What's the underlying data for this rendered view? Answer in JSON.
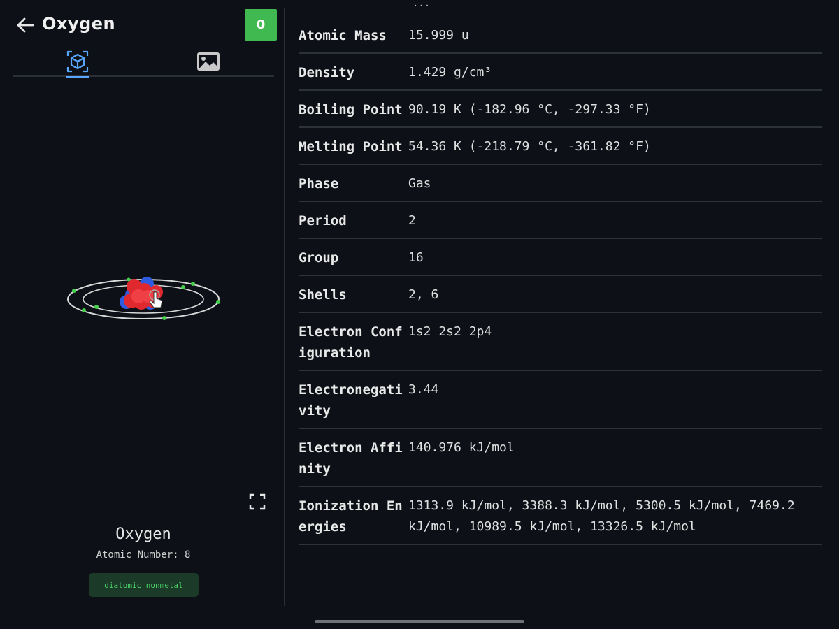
{
  "header": {
    "title": "Oxygen",
    "badge": "0"
  },
  "tabs": [
    {
      "icon": "atom-3d-icon",
      "active": true
    },
    {
      "icon": "image-icon",
      "active": false
    }
  ],
  "element": {
    "name": "Oxygen",
    "atomic_number_label": "Atomic Number: 8",
    "category": "diatomic nonmetal"
  },
  "properties": [
    {
      "key": "Atomic Mass",
      "value": "15.999 u"
    },
    {
      "key": "Density",
      "value": "1.429 g/cm³"
    },
    {
      "key": "Boiling Point",
      "value": "90.19 K (-182.96 °C, -297.33 °F)"
    },
    {
      "key": "Melting Point",
      "value": "54.36 K (-218.79 °C, -361.82 °F)"
    },
    {
      "key": "Phase",
      "value": "Gas"
    },
    {
      "key": "Period",
      "value": "2"
    },
    {
      "key": "Group",
      "value": "16"
    },
    {
      "key": "Shells",
      "value": "2, 6"
    },
    {
      "key": "Electron Configuration",
      "value": "1s2 2s2 2p4"
    },
    {
      "key": "Electronegativity",
      "value": "3.44"
    },
    {
      "key": "Electron Affinity",
      "value": "140.976 kJ/mol"
    },
    {
      "key": "Ionization Energies",
      "value": "1313.9 kJ/mol, 3388.3 kJ/mol, 5300.5 kJ/mol, 7469.2 kJ/mol, 10989.5 kJ/mol, 13326.5 kJ/mol"
    }
  ],
  "colors": {
    "background": "#0d1117",
    "accent": "#58a6ff",
    "badge": "#3fb950",
    "proton": "#e0292f",
    "neutron": "#2f5be0",
    "electron": "#44d04a"
  }
}
